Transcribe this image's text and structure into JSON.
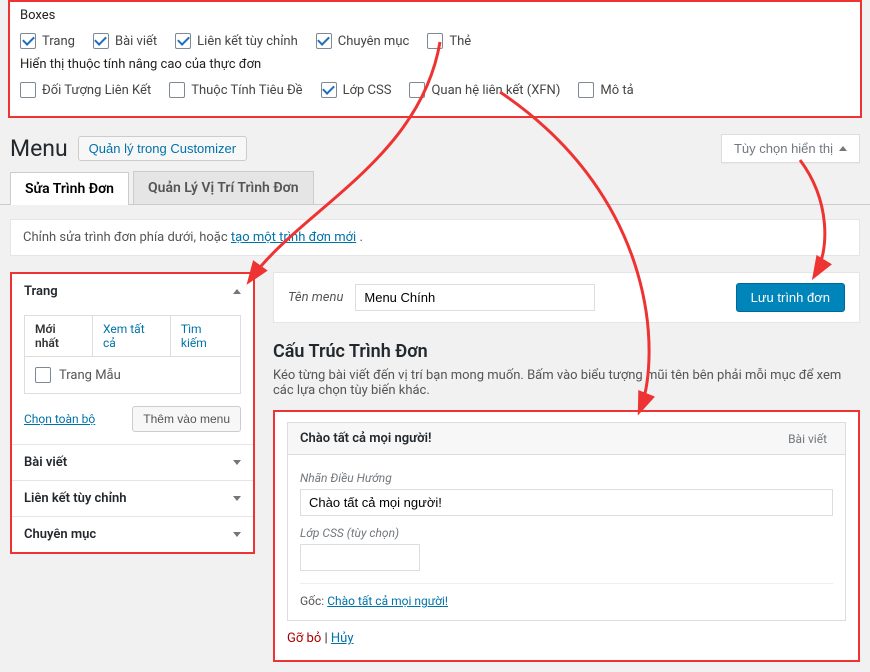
{
  "screen_options": {
    "boxes_title": "Boxes",
    "boxes": [
      {
        "label": "Trang",
        "checked": true
      },
      {
        "label": "Bài viết",
        "checked": true
      },
      {
        "label": "Liên kết tùy chỉnh",
        "checked": true
      },
      {
        "label": "Chuyên mục",
        "checked": true
      },
      {
        "label": "Thẻ",
        "checked": false
      }
    ],
    "advanced_title": "Hiển thị thuộc tính nâng cao của thực đơn",
    "advanced": [
      {
        "label": "Đối Tượng Liên Kết",
        "checked": false
      },
      {
        "label": "Thuộc Tính Tiêu Đề",
        "checked": false
      },
      {
        "label": "Lớp CSS",
        "checked": true
      },
      {
        "label": "Quan hệ liên kết (XFN)",
        "checked": false
      },
      {
        "label": "Mô tả",
        "checked": false
      }
    ],
    "toggle_label": "Tùy chọn hiển thị"
  },
  "header": {
    "page_title": "Menu",
    "customizer_button": "Quản lý trong Customizer"
  },
  "tabs": {
    "edit": "Sửa Trình Đơn",
    "locations": "Quản Lý Vị Trí Trình Đơn"
  },
  "info_bar": {
    "text_prefix": "Chỉnh sửa trình đơn phía dưới, hoặc ",
    "link": "tạo một trình đơn mới",
    "text_suffix": "."
  },
  "sidebar": {
    "panels": [
      {
        "title": "Trang",
        "open": true
      },
      {
        "title": "Bài viết",
        "open": false
      },
      {
        "title": "Liên kết tùy chỉnh",
        "open": false
      },
      {
        "title": "Chuyên mục",
        "open": false
      }
    ],
    "mini_tabs": {
      "recent": "Mới nhất",
      "all": "Xem tất cả",
      "search": "Tìm kiếm"
    },
    "sample_page": "Trang Mẫu",
    "select_all": "Chọn toàn bộ",
    "add_to_menu": "Thêm vào menu"
  },
  "menu": {
    "name_label": "Tên menu",
    "name_value": "Menu Chính",
    "save_button": "Lưu trình đơn",
    "structure_title": "Cấu Trúc Trình Đơn",
    "structure_desc": "Kéo từng bài viết đến vị trí bạn mong muốn. Bấm vào biểu tượng mũi tên bên phải mỗi mục để xem các lựa chọn tùy biến khác."
  },
  "menu_item": {
    "title": "Chào tất cả mọi người!",
    "type_label": "Bài viết",
    "nav_label_caption": "Nhãn Điều Hướng",
    "nav_label_value": "Chào tất cả mọi người!",
    "css_label": "Lớp CSS (tùy chọn)",
    "css_value": "",
    "origin_prefix": "Gốc: ",
    "origin_link": "Chào tất cả mọi người!",
    "remove": "Gỡ bỏ",
    "cancel": "Hủy"
  }
}
